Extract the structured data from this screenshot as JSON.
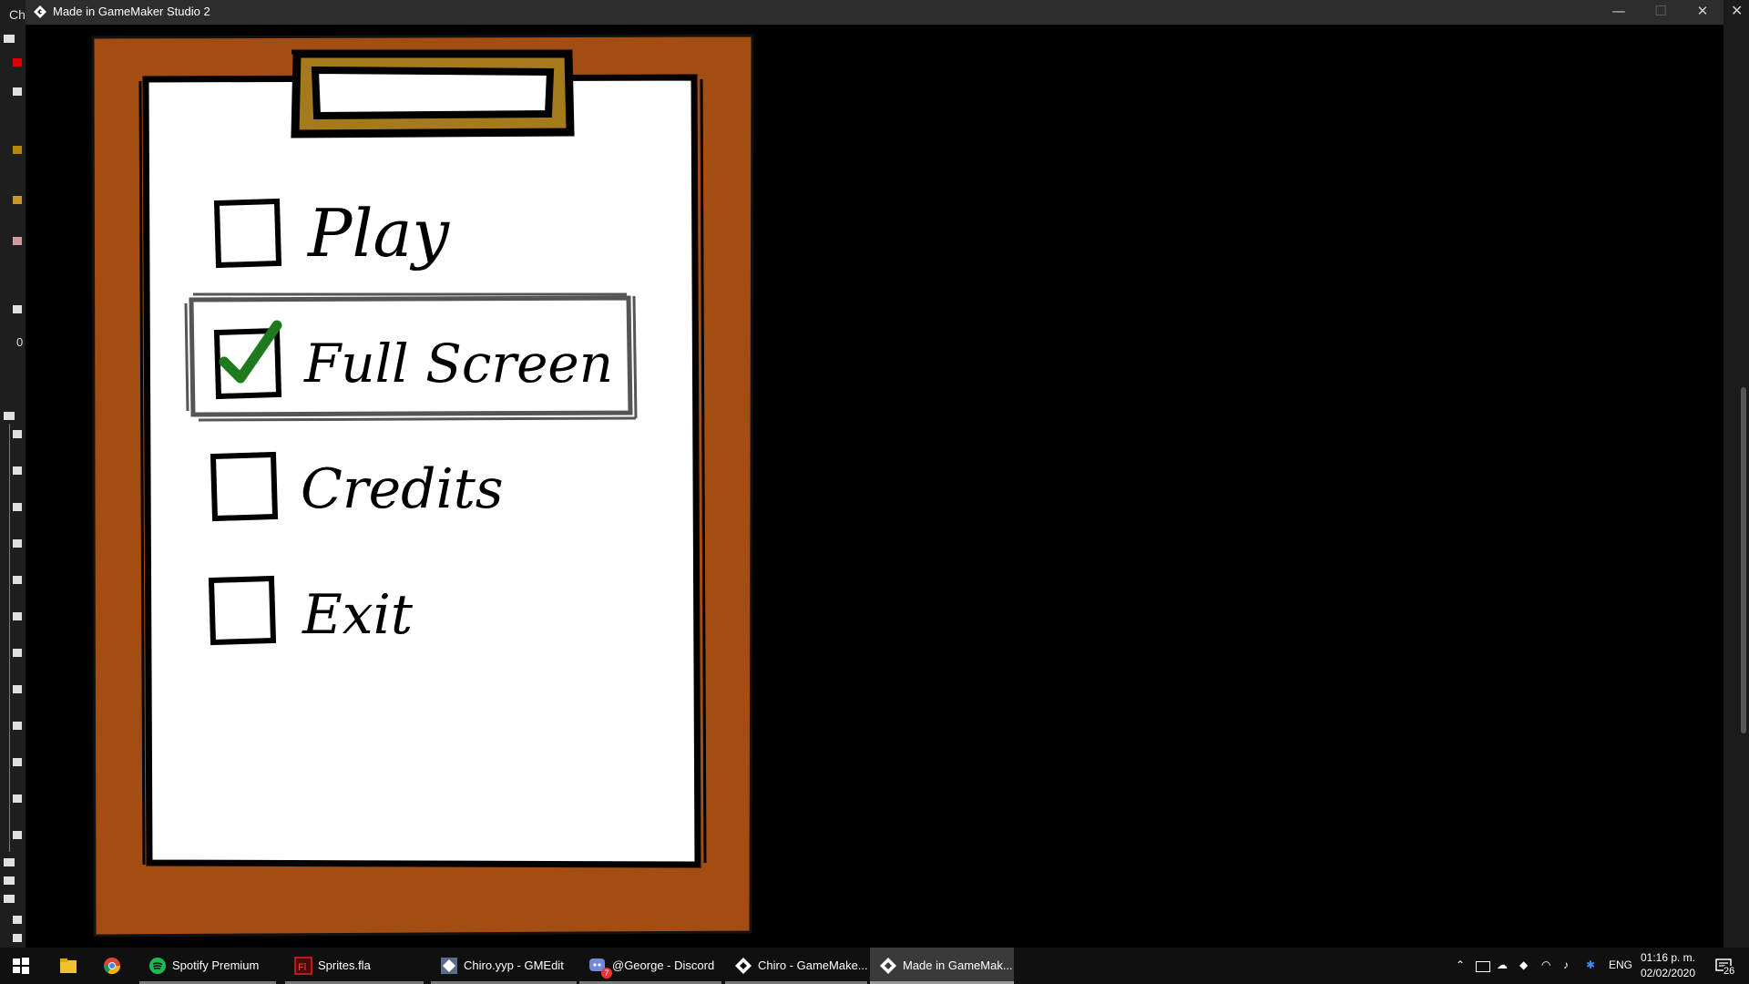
{
  "window": {
    "title": "Made in GameMaker Studio 2",
    "minimize": "—",
    "maximize": "☐",
    "close": "✕"
  },
  "background_app": {
    "title_fragment": "Ch",
    "counter": "0"
  },
  "menu": {
    "items": [
      {
        "label": "Play",
        "checked": false,
        "selected": false
      },
      {
        "label": "Full Screen",
        "checked": true,
        "selected": true
      },
      {
        "label": "Credits",
        "checked": false,
        "selected": false
      },
      {
        "label": "Exit",
        "checked": false,
        "selected": false
      }
    ]
  },
  "colors": {
    "clipboard_wood": "#a34d12",
    "clip_gold": "#a57a1c",
    "paper": "#ffffff",
    "check_green": "#1f7a1f",
    "selection_outline": "#555555"
  },
  "taskbar": {
    "apps": [
      {
        "label": "",
        "icon": "windows-start-icon"
      },
      {
        "label": "",
        "icon": "file-explorer-icon"
      },
      {
        "label": "",
        "icon": "chrome-icon"
      },
      {
        "label": "Spotify Premium",
        "icon": "spotify-icon"
      },
      {
        "label": "Sprites.fla",
        "icon": "flash-icon"
      },
      {
        "label": "Chiro.yyp - GMEdit",
        "icon": "gmedit-icon"
      },
      {
        "label": "@George - Discord",
        "icon": "discord-icon",
        "badge": "7"
      },
      {
        "label": "Chiro - GameMake...",
        "icon": "gamemaker-icon"
      },
      {
        "label": "Made in GameMak...",
        "icon": "gamemaker-icon",
        "active": true
      }
    ],
    "tray": {
      "language": "ENG",
      "time": "01:16 p. m.",
      "date": "02/02/2020",
      "notifications": "26"
    }
  }
}
